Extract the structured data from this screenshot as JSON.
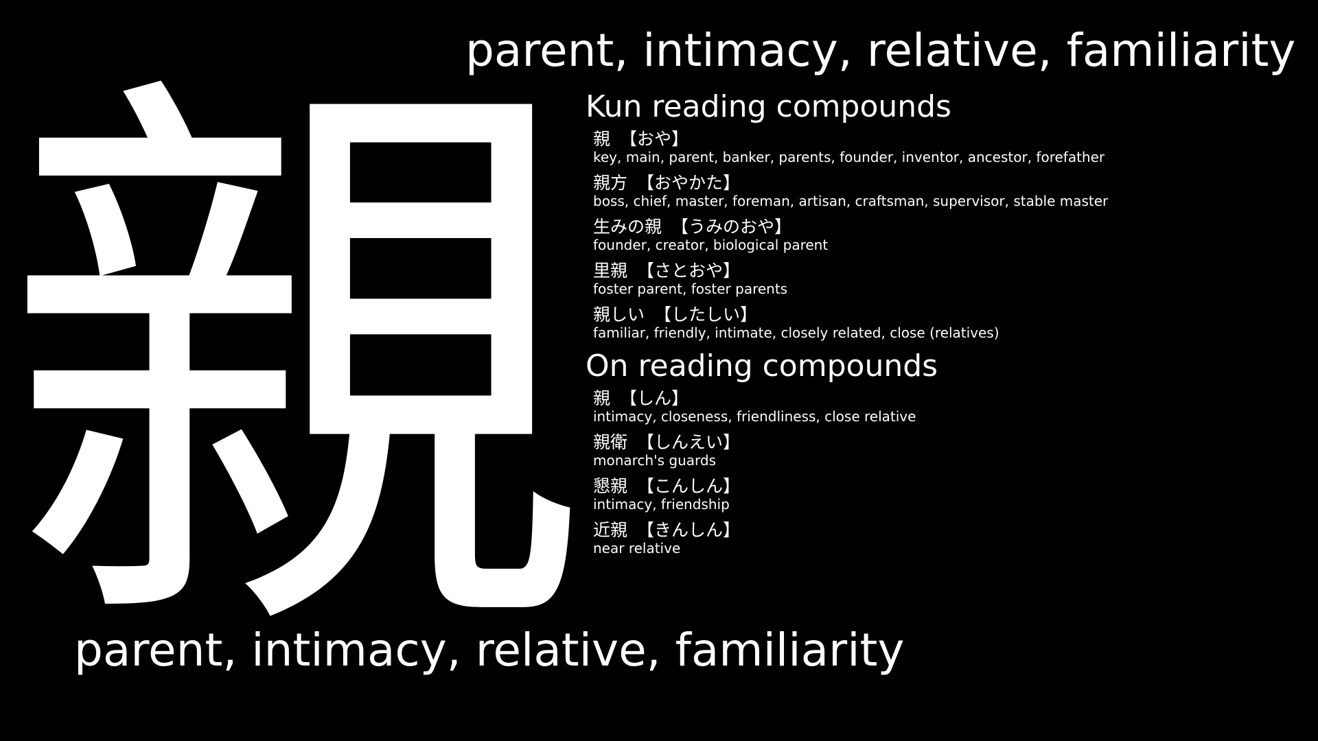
{
  "kanji": "親",
  "meaning": "parent, intimacy, relative, familiarity",
  "kun": {
    "heading": "Kun reading compounds",
    "entries": [
      {
        "word": "親",
        "reading": "【おや】",
        "meaning": "key, main, parent, banker, parents, founder, inventor, ancestor, forefather"
      },
      {
        "word": "親方",
        "reading": "【おやかた】",
        "meaning": "boss, chief, master, foreman, artisan, craftsman, supervisor, stable master"
      },
      {
        "word": "生みの親",
        "reading": "【うみのおや】",
        "meaning": "founder, creator, biological parent"
      },
      {
        "word": "里親",
        "reading": "【さとおや】",
        "meaning": "foster parent, foster parents"
      },
      {
        "word": "親しい",
        "reading": "【したしい】",
        "meaning": "familiar, friendly, intimate, closely related, close (relatives)"
      }
    ]
  },
  "on": {
    "heading": "On reading compounds",
    "entries": [
      {
        "word": "親",
        "reading": "【しん】",
        "meaning": "intimacy, closeness, friendliness, close relative"
      },
      {
        "word": "親衛",
        "reading": "【しんえい】",
        "meaning": "monarch's guards"
      },
      {
        "word": "懇親",
        "reading": "【こんしん】",
        "meaning": "intimacy, friendship"
      },
      {
        "word": "近親",
        "reading": "【きんしん】",
        "meaning": "near relative"
      }
    ]
  }
}
